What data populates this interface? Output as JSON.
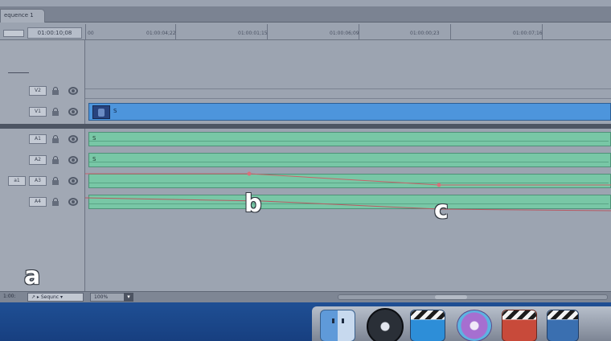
{
  "window": {
    "tab_label": "equence 1"
  },
  "timeline": {
    "current_timecode": "01:00:10;08",
    "ruler_labels": [
      "00",
      "01:00:04;22",
      "01:00:01;15",
      "01:00:06;09",
      "01:00:00;23",
      "01:00:07;16"
    ],
    "video_tracks": [
      {
        "label": "V2",
        "patch": ""
      },
      {
        "label": "V1",
        "patch": ""
      }
    ],
    "audio_tracks": [
      {
        "label": "A1",
        "patch": ""
      },
      {
        "label": "A2",
        "patch": ""
      },
      {
        "label": "A3",
        "patch": "a1"
      },
      {
        "label": "A4",
        "patch": ""
      }
    ],
    "video_clip_name": "S",
    "audio_clip_names": [
      "S",
      "S"
    ]
  },
  "callouts": {
    "a": "a",
    "b": "b",
    "c": "c"
  },
  "bottom_bar": {
    "left_text": "1:00:",
    "tool_label": "↗ ▸ Sequnc ▾",
    "zoom_value": "100%",
    "zoom_arrow": "▾"
  },
  "dock": {
    "items": [
      "finder-icon",
      "dvd-player-icon",
      "clapperboard-icon",
      "disc-icon",
      "clapperboard-red-icon",
      "clapperboard-blue-icon"
    ]
  }
}
